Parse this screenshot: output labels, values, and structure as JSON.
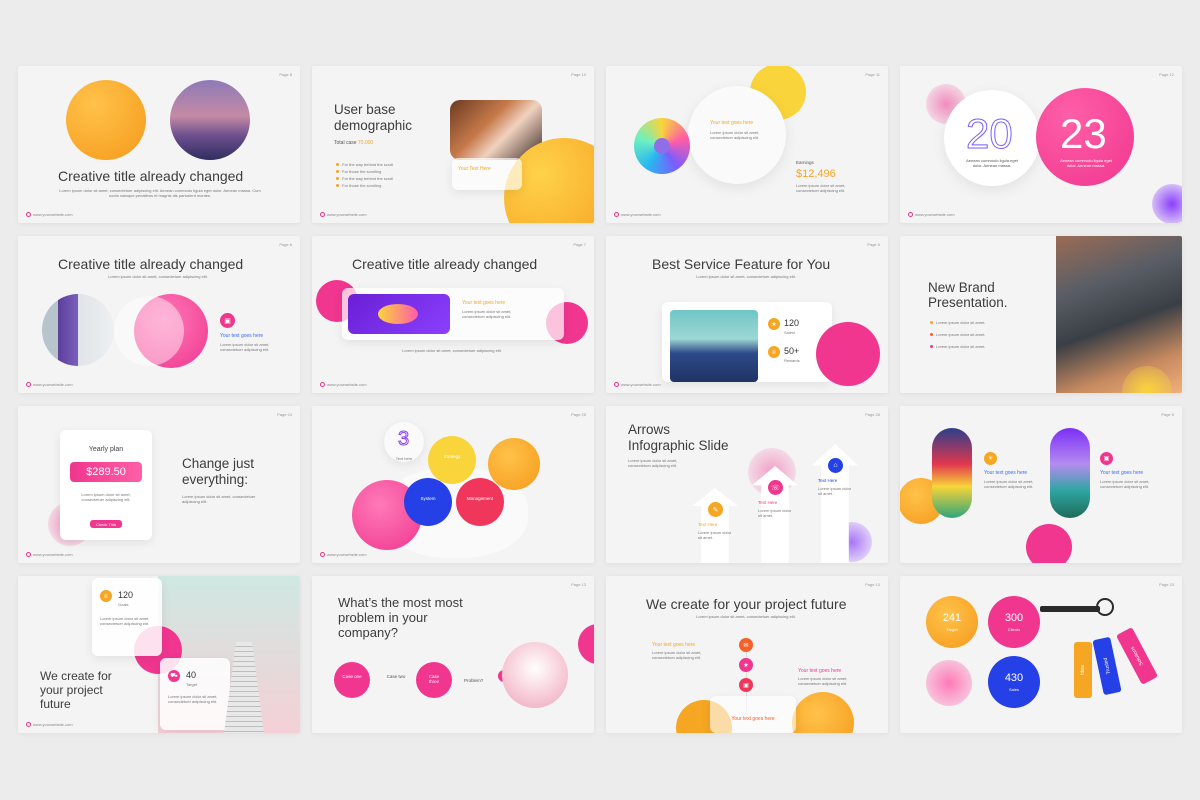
{
  "common": {
    "footer_url": "www.yourwebsite.com",
    "lorem": "Lorem ipsum dolor sit amet, consectetuer adipiscing elit.",
    "lorem_short": "Lorem ipsum dolor sit amet."
  },
  "colors": {
    "orange": "#f5a623",
    "pink": "#f0368f",
    "blue": "#2440e6",
    "purple": "#7b2ff7",
    "background": "#ececec",
    "slide": "#f4f4f4"
  },
  "slides": {
    "s1": {
      "page": "Page 8",
      "title": "Creative title already changed",
      "body": "Lorem ipsum dolor sit amet, consectetuer adipiscing elit. Aenean commodo ligula eget dolor. Aenean massa. Cum sociis natoque penatibus et magnis dis parturient montes."
    },
    "s2": {
      "page": "Page 10",
      "title_line1": "User base",
      "title_line2": "demographic",
      "total_label": "Total case",
      "total_value": "70.000",
      "bullets": [
        "For the way behind the scroll",
        "For those the scrolling",
        "For the way behind the scroll",
        "For those the scrolling"
      ],
      "accent": "Your Text Here"
    },
    "s3": {
      "page": "Page 11",
      "accent": "Your text goes here",
      "earnings_label": "Earnings",
      "earnings_value": "$12,496"
    },
    "s4": {
      "page": "Page 12",
      "year_left": "20",
      "year_right": "23",
      "left_text": "Aenean commodo ligula eget dolor. Aenean massa.",
      "right_text": "Aenean commodo ligula eget dolor. Aenean massa."
    },
    "s5": {
      "page": "Page 6",
      "title": "Creative title already changed",
      "accent": "Your text goes here"
    },
    "s6": {
      "page": "Page 7",
      "title": "Creative title already changed",
      "accent": "Your text goes here"
    },
    "s7": {
      "page": "Page 6",
      "title": "Best Service Feature for You",
      "stat1_value": "120",
      "stat1_label": "Sales!",
      "stat2_value": "50+",
      "stat2_label": "Rewards"
    },
    "s8": {
      "title_line1": "New Brand",
      "title_line2": "Presentation."
    },
    "s9": {
      "page": "Page 24",
      "plan_label": "Yearly plan",
      "price": "$289.50",
      "button": "Check This",
      "headline_line1": "Change just",
      "headline_line2": "everything:"
    },
    "s10": {
      "page": "Page 25",
      "big_number": "3",
      "big_label": "Text here",
      "bubbles": [
        "Strategy",
        "System",
        "Management"
      ]
    },
    "s11": {
      "page": "Page 28",
      "title_line1": "Arrows",
      "title_line2": "Infographic Slide",
      "arrow_labels": [
        "Text Here",
        "Text Here",
        "Text Here"
      ]
    },
    "s12": {
      "page": "Page 5",
      "accent_left": "Your text goes here",
      "accent_right": "Your text goes here"
    },
    "s13": {
      "stat1_value": "120",
      "stat1_label": "Goals",
      "stat2_value": "40",
      "stat2_label": "Target",
      "headline_line1": "We create for",
      "headline_line2": "your project",
      "headline_line3": "future"
    },
    "s14": {
      "page": "Page 13",
      "title_line1": "What’s the most most",
      "title_line2": "problem in your",
      "title_line3": "company?",
      "case_one": "Case one",
      "case_two": "Case two",
      "case_three": "Case three",
      "problem": "Problem?"
    },
    "s15": {
      "page": "Page 13",
      "title": "We create for your project future",
      "accent1": "Your text goes here",
      "accent2": "Your text goes here",
      "accent3": "Your text goes here"
    },
    "s16": {
      "page": "Page 23",
      "stats": [
        {
          "value": "241",
          "label": "Target"
        },
        {
          "value": "300",
          "label": "Clients"
        },
        {
          "value": "430",
          "label": "Sales"
        }
      ],
      "tags": [
        "Idea",
        "Trusted",
        "Solutions"
      ]
    }
  }
}
